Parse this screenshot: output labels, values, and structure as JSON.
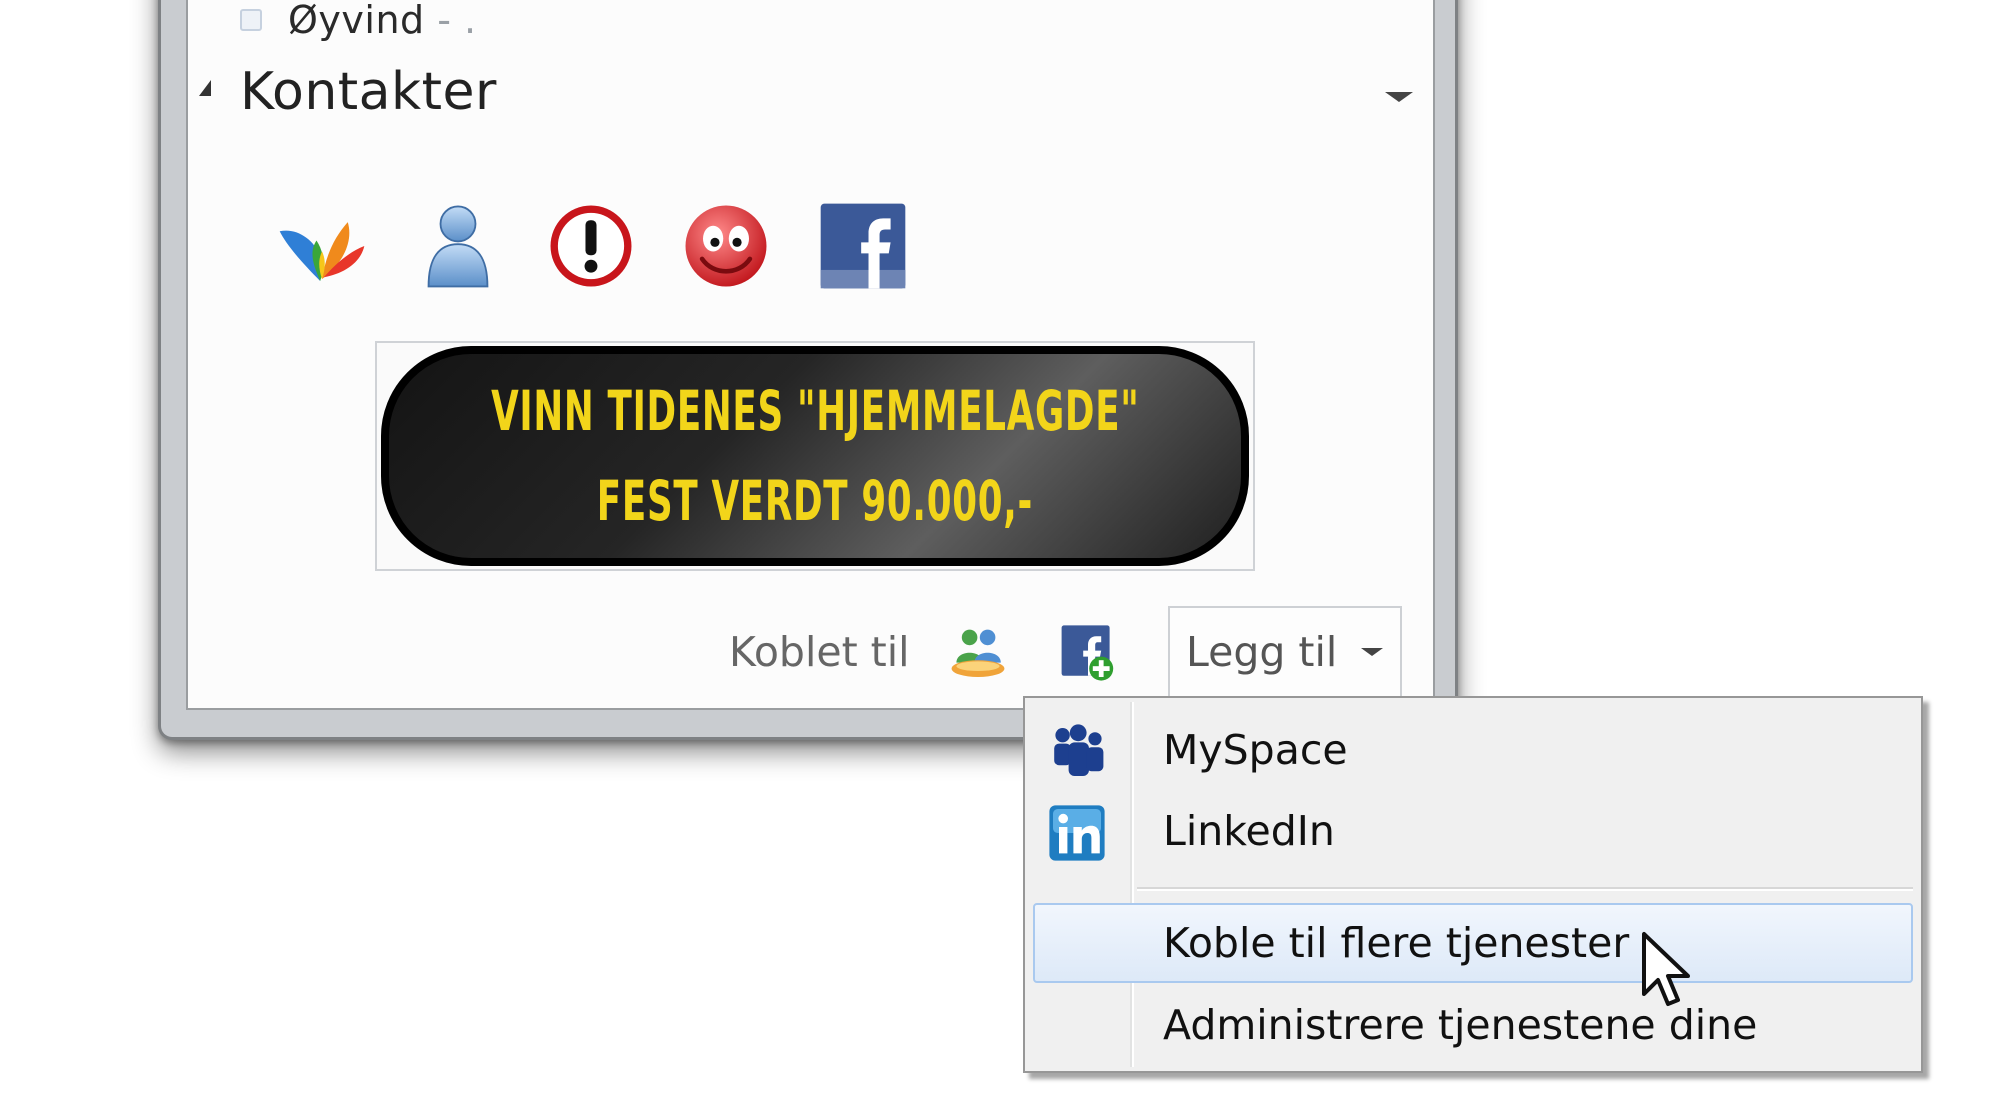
{
  "contact": {
    "name": "Øyvind",
    "status": "- ."
  },
  "group": {
    "title": "Kontakter"
  },
  "service_icons": [
    "msn-butterfly-icon",
    "person-icon",
    "alert-icon",
    "smiley-icon",
    "facebook-icon"
  ],
  "banner": {
    "line1": "VINN TIDENES \"HJEMMELAGDE\"",
    "line2": "FEST VERDT 90.000,-"
  },
  "toolbar": {
    "connected_label": "Koblet til",
    "add_label": "Legg til"
  },
  "menu": {
    "items": [
      {
        "label": "MySpace",
        "icon": "myspace-icon"
      },
      {
        "label": "LinkedIn",
        "icon": "linkedin-icon"
      },
      {
        "label": "Koble til flere tjenester",
        "highlighted": true
      },
      {
        "label": "Administrere tjenestene dine"
      }
    ]
  },
  "colors": {
    "banner_text": "#f2d51a",
    "menu_highlight": "#dde9f8",
    "facebook_blue": "#3b5998",
    "linkedin_blue": "#1f7dc1"
  }
}
